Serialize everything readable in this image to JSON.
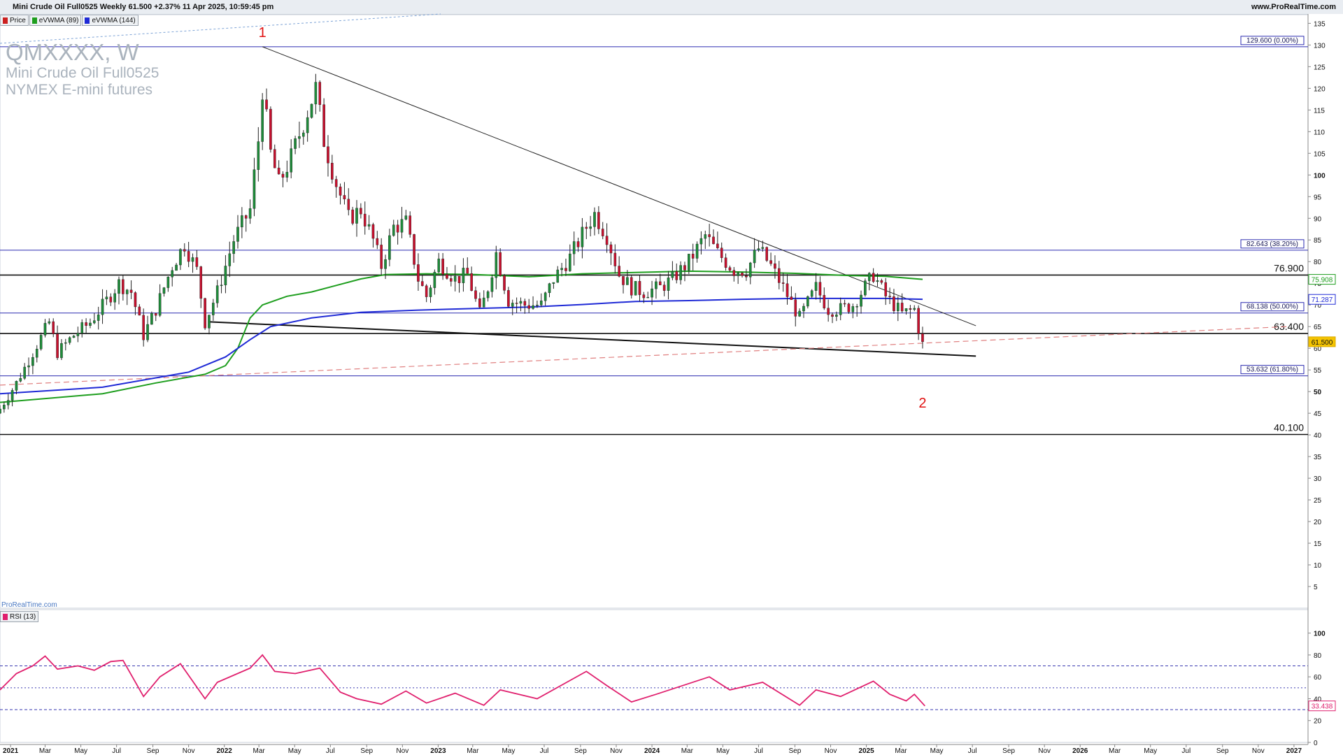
{
  "header": {
    "title_text": "Mini Crude Oil Full0525 Weekly 61.500 +2.37% 11 Apr 2025, 10:59:45 pm",
    "site": "www.ProRealTime.com"
  },
  "legend": [
    {
      "label": "Price",
      "color": "#cc2020"
    },
    {
      "label": "eVWMA (89)",
      "color": "#1e9e1e"
    },
    {
      "label": "eVWMA (144)",
      "color": "#1f2ad6"
    }
  ],
  "watermark": {
    "symbol": "QMXXXX, W",
    "name": "Mini Crude Oil Full0525",
    "exchange": "NYMEX E-mini futures"
  },
  "footer_brand": "ProRealTime.com",
  "rsi_legend": {
    "label": "RSI (13)",
    "color": "#e0206e"
  },
  "colors": {
    "up": "#1e8c3a",
    "down": "#c8102e",
    "fib": "#2b2bb0",
    "evwma89": "#1e9e1e",
    "evwma144": "#1f2ad6",
    "rsi": "#e0206e",
    "grid_dash": "#3a3ab0",
    "support": "#111111",
    "trend_dash": "#e08080"
  },
  "chart_data": [
    {
      "type": "candlestick",
      "ylim": [
        0,
        137
      ],
      "xlim": [
        "2020-12-14",
        "2027-01-25"
      ],
      "y_ticks": [
        0,
        5,
        10,
        15,
        20,
        25,
        30,
        35,
        40,
        45,
        50,
        55,
        60,
        65,
        70,
        75,
        80,
        85,
        90,
        95,
        100,
        105,
        110,
        115,
        120,
        125,
        130,
        135
      ],
      "y_ticks_bold": [
        50,
        100
      ],
      "x_ticks": [
        {
          "date": "2021-01-01",
          "label": "2021",
          "bold": true
        },
        {
          "date": "2021-03-01",
          "label": "Mar"
        },
        {
          "date": "2021-05-01",
          "label": "May"
        },
        {
          "date": "2021-07-01",
          "label": "Jul"
        },
        {
          "date": "2021-09-01",
          "label": "Sep"
        },
        {
          "date": "2021-11-01",
          "label": "Nov"
        },
        {
          "date": "2022-01-01",
          "label": "2022",
          "bold": true
        },
        {
          "date": "2022-03-01",
          "label": "Mar"
        },
        {
          "date": "2022-05-01",
          "label": "May"
        },
        {
          "date": "2022-07-01",
          "label": "Jul"
        },
        {
          "date": "2022-09-01",
          "label": "Sep"
        },
        {
          "date": "2022-11-01",
          "label": "Nov"
        },
        {
          "date": "2023-01-01",
          "label": "2023",
          "bold": true
        },
        {
          "date": "2023-03-01",
          "label": "Mar"
        },
        {
          "date": "2023-05-01",
          "label": "May"
        },
        {
          "date": "2023-07-01",
          "label": "Jul"
        },
        {
          "date": "2023-09-01",
          "label": "Sep"
        },
        {
          "date": "2023-11-01",
          "label": "Nov"
        },
        {
          "date": "2024-01-01",
          "label": "2024",
          "bold": true
        },
        {
          "date": "2024-03-01",
          "label": "Mar"
        },
        {
          "date": "2024-05-01",
          "label": "May"
        },
        {
          "date": "2024-07-01",
          "label": "Jul"
        },
        {
          "date": "2024-09-01",
          "label": "Sep"
        },
        {
          "date": "2024-11-01",
          "label": "Nov"
        },
        {
          "date": "2025-01-01",
          "label": "2025",
          "bold": true
        },
        {
          "date": "2025-03-01",
          "label": "Mar"
        },
        {
          "date": "2025-05-01",
          "label": "May"
        },
        {
          "date": "2025-07-01",
          "label": "Jul"
        },
        {
          "date": "2025-09-01",
          "label": "Sep"
        },
        {
          "date": "2025-11-01",
          "label": "Nov"
        },
        {
          "date": "2026-01-01",
          "label": "2026",
          "bold": true
        },
        {
          "date": "2026-03-01",
          "label": "Mar"
        },
        {
          "date": "2026-05-01",
          "label": "May"
        },
        {
          "date": "2026-07-01",
          "label": "Jul"
        },
        {
          "date": "2026-09-01",
          "label": "Sep"
        },
        {
          "date": "2026-11-01",
          "label": "Nov"
        },
        {
          "date": "2027-01-01",
          "label": "2027",
          "bold": true
        }
      ],
      "price_path": [
        [
          "2020-12-14",
          46
        ],
        [
          "2021-01-11",
          52
        ],
        [
          "2021-02-08",
          59
        ],
        [
          "2021-03-08",
          66
        ],
        [
          "2021-03-22",
          59
        ],
        [
          "2021-04-19",
          63
        ],
        [
          "2021-05-17",
          66
        ],
        [
          "2021-06-14",
          71
        ],
        [
          "2021-07-05",
          75
        ],
        [
          "2021-07-26",
          73
        ],
        [
          "2021-08-16",
          63
        ],
        [
          "2021-09-06",
          69
        ],
        [
          "2021-10-04",
          79
        ],
        [
          "2021-10-25",
          84
        ],
        [
          "2021-11-15",
          78
        ],
        [
          "2021-11-29",
          66
        ],
        [
          "2021-12-20",
          73
        ],
        [
          "2022-01-17",
          85
        ],
        [
          "2022-02-14",
          92
        ],
        [
          "2022-02-28",
          108
        ],
        [
          "2022-03-07",
          120
        ],
        [
          "2022-03-21",
          105
        ],
        [
          "2022-04-04",
          98
        ],
        [
          "2022-04-25",
          104
        ],
        [
          "2022-05-16",
          112
        ],
        [
          "2022-06-06",
          120
        ],
        [
          "2022-06-20",
          108
        ],
        [
          "2022-07-11",
          98
        ],
        [
          "2022-08-01",
          90
        ],
        [
          "2022-08-22",
          92
        ],
        [
          "2022-09-12",
          85
        ],
        [
          "2022-09-26",
          79
        ],
        [
          "2022-10-17",
          88
        ],
        [
          "2022-11-07",
          89
        ],
        [
          "2022-11-28",
          76
        ],
        [
          "2022-12-12",
          72
        ],
        [
          "2023-01-02",
          80
        ],
        [
          "2023-01-30",
          76
        ],
        [
          "2023-02-20",
          77
        ],
        [
          "2023-03-13",
          68
        ],
        [
          "2023-03-27",
          74
        ],
        [
          "2023-04-10",
          82
        ],
        [
          "2023-05-01",
          71
        ],
        [
          "2023-05-29",
          70
        ],
        [
          "2023-06-26",
          70
        ],
        [
          "2023-07-17",
          76
        ],
        [
          "2023-08-14",
          81
        ],
        [
          "2023-09-11",
          88
        ],
        [
          "2023-09-25",
          91
        ],
        [
          "2023-10-16",
          86
        ],
        [
          "2023-11-06",
          77
        ],
        [
          "2023-11-27",
          74
        ],
        [
          "2023-12-18",
          73
        ],
        [
          "2024-01-15",
          74
        ],
        [
          "2024-02-05",
          76
        ],
        [
          "2024-03-04",
          80
        ],
        [
          "2024-04-01",
          86
        ],
        [
          "2024-04-22",
          82
        ],
        [
          "2024-05-20",
          78
        ],
        [
          "2024-06-10",
          78
        ],
        [
          "2024-07-01",
          83
        ],
        [
          "2024-07-22",
          79
        ],
        [
          "2024-08-12",
          74
        ],
        [
          "2024-09-09",
          67
        ],
        [
          "2024-10-07",
          74
        ],
        [
          "2024-10-28",
          69
        ],
        [
          "2024-11-18",
          69
        ],
        [
          "2024-12-09",
          70
        ],
        [
          "2025-01-13",
          77
        ],
        [
          "2025-02-03",
          72
        ],
        [
          "2025-03-03",
          68
        ],
        [
          "2025-03-24",
          69
        ],
        [
          "2025-04-07",
          60
        ],
        [
          "2025-04-11",
          61.5
        ]
      ],
      "last_price": 61.5,
      "swing_labels": [
        {
          "text": "1",
          "date": "2022-03-07",
          "y": 131.8
        },
        {
          "text": "2",
          "date": "2025-04-07",
          "y": 46.3
        }
      ],
      "horizontal_levels": [
        {
          "y": 129.6,
          "label": "129.600 (0.00%)",
          "style": "fib"
        },
        {
          "y": 82.643,
          "label": "82.643 (38.20%)",
          "style": "fib"
        },
        {
          "y": 76.9,
          "label": "76.900",
          "style": "support"
        },
        {
          "y": 68.138,
          "label": "68.138 (50.00%)",
          "style": "fib"
        },
        {
          "y": 63.4,
          "label": "63.400",
          "style": "support"
        },
        {
          "y": 53.632,
          "label": "53.632 (61.80%)",
          "style": "fib"
        },
        {
          "y": 40.1,
          "label": "40.100",
          "style": "support"
        }
      ],
      "trendlines": [
        {
          "from": [
            "2022-03-07",
            129.6
          ],
          "to": [
            "2025-07-07",
            65.2
          ],
          "style": "thin"
        },
        {
          "from": [
            "2021-12-06",
            66.1
          ],
          "to": [
            "2025-07-07",
            58.2
          ],
          "style": "thick"
        },
        {
          "from": [
            "2020-12-14",
            51.5
          ],
          "to": [
            "2026-12-21",
            65.0
          ],
          "style": "dash"
        }
      ],
      "series": [
        {
          "name": "eVWMA (89)",
          "current": 75.908,
          "points": [
            [
              "2020-12-14",
              47.5
            ],
            [
              "2021-06-07",
              49.5
            ],
            [
              "2021-09-06",
              52
            ],
            [
              "2021-11-29",
              54
            ],
            [
              "2022-01-03",
              56
            ],
            [
              "2022-01-24",
              60
            ],
            [
              "2022-02-14",
              67
            ],
            [
              "2022-03-07",
              70
            ],
            [
              "2022-04-18",
              72
            ],
            [
              "2022-05-30",
              73
            ],
            [
              "2022-07-11",
              74.5
            ],
            [
              "2022-08-22",
              76
            ],
            [
              "2022-10-03",
              77
            ],
            [
              "2022-12-12",
              77.2
            ],
            [
              "2023-03-06",
              77
            ],
            [
              "2023-06-05",
              76.5
            ],
            [
              "2023-09-04",
              77.2
            ],
            [
              "2023-12-04",
              77.5
            ],
            [
              "2024-03-04",
              77.8
            ],
            [
              "2024-06-03",
              77.6
            ],
            [
              "2024-09-02",
              77.3
            ],
            [
              "2024-12-02",
              76.8
            ],
            [
              "2025-02-03",
              76.6
            ],
            [
              "2025-04-07",
              75.9
            ]
          ]
        },
        {
          "name": "eVWMA (144)",
          "current": 71.287,
          "points": [
            [
              "2020-12-14",
              49.5
            ],
            [
              "2021-06-07",
              51
            ],
            [
              "2021-11-01",
              54.5
            ],
            [
              "2022-01-03",
              58
            ],
            [
              "2022-02-14",
              62
            ],
            [
              "2022-03-21",
              65
            ],
            [
              "2022-05-30",
              67
            ],
            [
              "2022-08-22",
              68.3
            ],
            [
              "2022-11-28",
              68.8
            ],
            [
              "2023-03-06",
              69.2
            ],
            [
              "2023-06-05",
              69.5
            ],
            [
              "2023-09-04",
              70.1
            ],
            [
              "2023-12-04",
              70.8
            ],
            [
              "2024-03-04",
              71.0
            ],
            [
              "2024-06-03",
              71.3
            ],
            [
              "2024-09-02",
              71.5
            ],
            [
              "2024-12-02",
              71.5
            ],
            [
              "2025-02-03",
              71.5
            ],
            [
              "2025-04-07",
              71.3
            ]
          ]
        }
      ],
      "current_value_labels": [
        {
          "y": 75.908,
          "text": "75.908",
          "color": "#1e9e1e"
        },
        {
          "y": 71.287,
          "text": "71.287",
          "color": "#1f2ad6"
        },
        {
          "y": 61.5,
          "text": "61.500",
          "color": "#d6a800"
        }
      ]
    },
    {
      "type": "line",
      "name": "RSI (13)",
      "ylim": [
        0,
        110
      ],
      "y_ticks": [
        0,
        20,
        40,
        60,
        80,
        100
      ],
      "reference_lines": [
        30,
        50,
        70
      ],
      "current": 33.438,
      "current_text": "33.438",
      "points": [
        [
          "2020-12-14",
          48
        ],
        [
          "2021-01-11",
          63
        ],
        [
          "2021-02-08",
          70
        ],
        [
          "2021-03-01",
          79
        ],
        [
          "2021-03-22",
          67
        ],
        [
          "2021-04-26",
          70
        ],
        [
          "2021-05-24",
          66
        ],
        [
          "2021-06-21",
          74
        ],
        [
          "2021-07-12",
          75
        ],
        [
          "2021-08-16",
          42
        ],
        [
          "2021-09-13",
          60
        ],
        [
          "2021-10-18",
          72
        ],
        [
          "2021-11-29",
          40
        ],
        [
          "2021-12-20",
          55
        ],
        [
          "2022-02-14",
          68
        ],
        [
          "2022-03-07",
          80
        ],
        [
          "2022-03-28",
          65
        ],
        [
          "2022-05-02",
          63
        ],
        [
          "2022-06-13",
          68
        ],
        [
          "2022-07-18",
          46
        ],
        [
          "2022-08-15",
          40
        ],
        [
          "2022-09-26",
          35
        ],
        [
          "2022-11-07",
          47
        ],
        [
          "2022-12-12",
          36
        ],
        [
          "2023-01-30",
          45
        ],
        [
          "2023-03-20",
          34
        ],
        [
          "2023-04-17",
          48
        ],
        [
          "2023-06-19",
          40
        ],
        [
          "2023-09-11",
          65
        ],
        [
          "2023-10-16",
          52
        ],
        [
          "2023-11-27",
          37
        ],
        [
          "2024-01-08",
          44
        ],
        [
          "2024-04-08",
          60
        ],
        [
          "2024-05-13",
          48
        ],
        [
          "2024-07-08",
          55
        ],
        [
          "2024-09-09",
          34
        ],
        [
          "2024-10-07",
          48
        ],
        [
          "2024-11-18",
          42
        ],
        [
          "2025-01-13",
          56
        ],
        [
          "2025-02-10",
          44
        ],
        [
          "2025-03-10",
          38
        ],
        [
          "2025-03-24",
          44
        ],
        [
          "2025-04-11",
          33.4
        ]
      ]
    }
  ]
}
